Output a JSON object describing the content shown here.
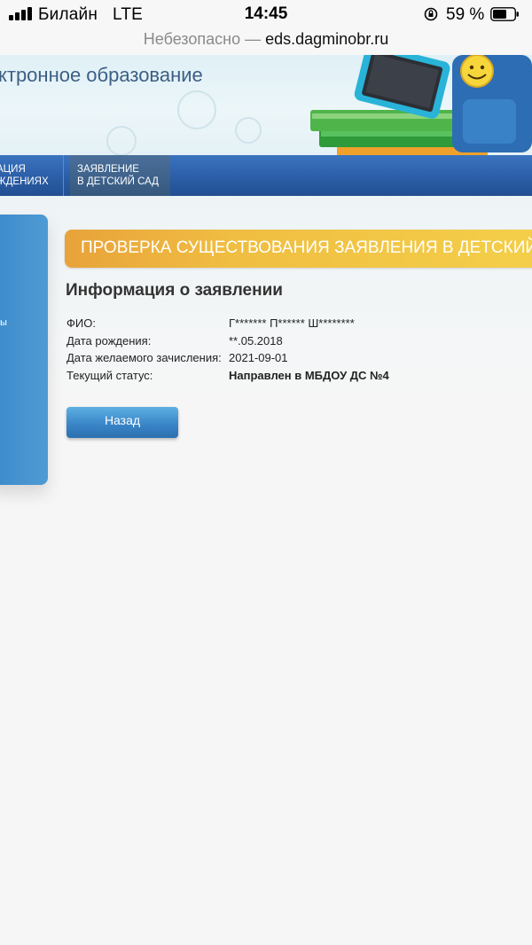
{
  "status_bar": {
    "carrier": "Билайн",
    "network": "LTE",
    "time": "14:45",
    "battery_percent": "59 %",
    "icons": [
      "signal-bars-icon",
      "orientation-lock-icon",
      "battery-icon"
    ]
  },
  "browser": {
    "insecure_label": "Небезопасно",
    "separator": "—",
    "host": "eds.dagminobr.ru"
  },
  "header": {
    "site_title": "ктронное образование"
  },
  "nav": {
    "items": [
      {
        "line1": "АЦИЯ",
        "line2": "ЖДЕНИЯХ"
      },
      {
        "line1": "ЗАЯВЛЕНИЕ",
        "line2": "В ДЕТСКИЙ САД"
      }
    ]
  },
  "sidebar": {
    "text": "ы"
  },
  "banner": {
    "title": "ПРОВЕРКА СУЩЕСТВОВАНИЯ ЗАЯВЛЕНИЯ В ДЕТСКИЙ"
  },
  "main": {
    "section_title": "Информация о заявлении",
    "rows": [
      {
        "label": "ФИО:",
        "value": "Г******* П****** Ш********",
        "bold": false
      },
      {
        "label": "Дата рождения:",
        "value": "**.05.2018",
        "bold": false
      },
      {
        "label": "Дата желаемого зачисления:",
        "value": "2021-09-01",
        "bold": false
      },
      {
        "label": "Текущий статус:",
        "value": "Направлен в МБДОУ ДС №4",
        "bold": true
      }
    ],
    "back_button": "Назад"
  },
  "colors": {
    "nav_blue": "#2b5ea6",
    "banner_orange": "#f0be42",
    "button_blue": "#3a86c8",
    "title_blue": "#3c5f84"
  }
}
